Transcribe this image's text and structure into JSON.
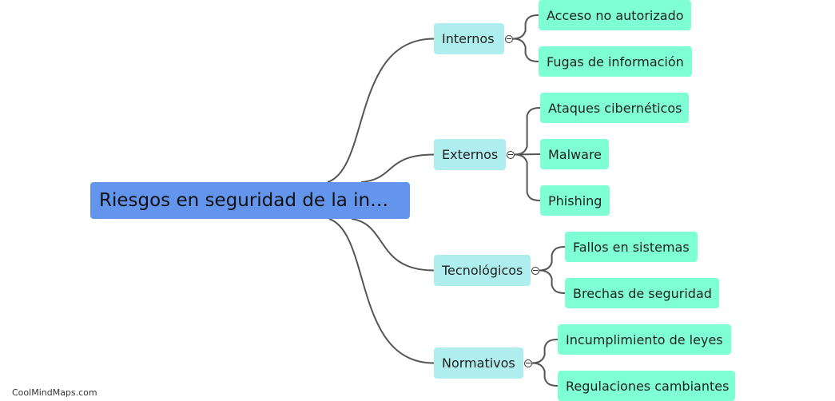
{
  "root": {
    "label": "Riesgos en seguridad de la in…"
  },
  "branches": [
    {
      "label": "Internos",
      "children": [
        "Acceso no autorizado",
        "Fugas de información"
      ]
    },
    {
      "label": "Externos",
      "children": [
        "Ataques cibernéticos",
        "Malware",
        "Phishing"
      ]
    },
    {
      "label": "Tecnológicos",
      "children": [
        "Fallos en sistemas",
        "Brechas de seguridad"
      ]
    },
    {
      "label": "Normativos",
      "children": [
        "Incumplimiento de leyes",
        "Regulaciones cambiantes"
      ]
    }
  ],
  "toggle_icon": "collapse-minus-icon",
  "colors": {
    "root": "#6495ED",
    "branch": "#AFEEEE",
    "leaf": "#7FFFD4",
    "edge": "#555555"
  },
  "footer": {
    "watermark": "CoolMindMaps.com"
  }
}
